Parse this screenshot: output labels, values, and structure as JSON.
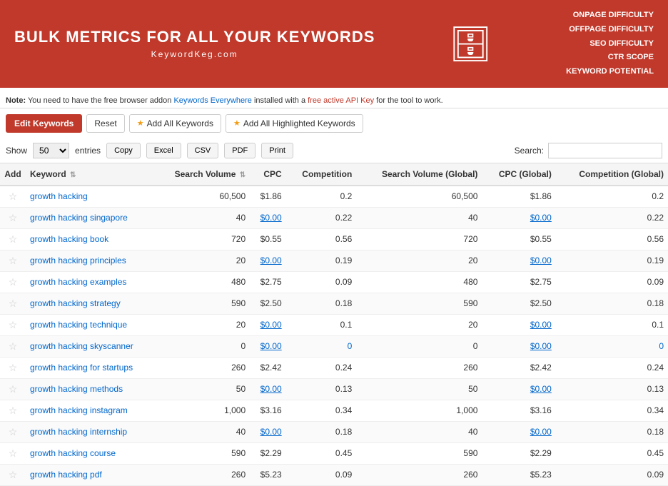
{
  "banner": {
    "title": "BULK METRICS FOR ALL YOUR KEYWORDS",
    "subtitle": "KeywordKeg.com",
    "metrics": [
      "ONPAGE DIFFICULTY",
      "OFFPAGE DIFFICULTY",
      "SEO DIFFICULTY",
      "CTR SCOPE",
      "KEYWORD POTENTIAL"
    ]
  },
  "note": {
    "prefix": "Note:",
    "text1": "You need to have the free browser addon ",
    "link1": "Keywords Everywhere",
    "text2": " installed with a ",
    "link2": "free active API Key",
    "text3": " for the tool to work."
  },
  "toolbar": {
    "edit_label": "Edit Keywords",
    "reset_label": "Reset",
    "add_all_label": "Add All Keywords",
    "add_highlighted_label": "Add All Highlighted Keywords"
  },
  "show_row": {
    "show_label": "Show",
    "entries_value": "50",
    "entries_label": "entries",
    "buttons": [
      "Copy",
      "Excel",
      "CSV",
      "PDF",
      "Print"
    ],
    "search_label": "Search:"
  },
  "table": {
    "headers": [
      "Add",
      "Keyword",
      "Search Volume",
      "CPC",
      "Competition",
      "Search Volume (Global)",
      "CPC (Global)",
      "Competition (Global)"
    ],
    "rows": [
      {
        "keyword": "growth hacking",
        "sv": "60,500",
        "cpc": "$1.86",
        "comp": "0.2",
        "sv_global": "60,500",
        "cpc_global": "$1.86",
        "comp_global": "0.2"
      },
      {
        "keyword": "growth hacking singapore",
        "sv": "40",
        "cpc": "$0.00",
        "comp": "0.22",
        "sv_global": "40",
        "cpc_global": "$0.00",
        "comp_global": "0.22"
      },
      {
        "keyword": "growth hacking book",
        "sv": "720",
        "cpc": "$0.55",
        "comp": "0.56",
        "sv_global": "720",
        "cpc_global": "$0.55",
        "comp_global": "0.56"
      },
      {
        "keyword": "growth hacking principles",
        "sv": "20",
        "cpc": "$0.00",
        "comp": "0.19",
        "sv_global": "20",
        "cpc_global": "$0.00",
        "comp_global": "0.19"
      },
      {
        "keyword": "growth hacking examples",
        "sv": "480",
        "cpc": "$2.75",
        "comp": "0.09",
        "sv_global": "480",
        "cpc_global": "$2.75",
        "comp_global": "0.09"
      },
      {
        "keyword": "growth hacking strategy",
        "sv": "590",
        "cpc": "$2.50",
        "comp": "0.18",
        "sv_global": "590",
        "cpc_global": "$2.50",
        "comp_global": "0.18"
      },
      {
        "keyword": "growth hacking technique",
        "sv": "20",
        "cpc": "$0.00",
        "comp": "0.1",
        "sv_global": "20",
        "cpc_global": "$0.00",
        "comp_global": "0.1"
      },
      {
        "keyword": "growth hacking skyscanner",
        "sv": "0",
        "cpc": "$0.00",
        "comp": "0",
        "sv_global": "0",
        "cpc_global": "$0.00",
        "comp_global": "0"
      },
      {
        "keyword": "growth hacking for startups",
        "sv": "260",
        "cpc": "$2.42",
        "comp": "0.24",
        "sv_global": "260",
        "cpc_global": "$2.42",
        "comp_global": "0.24"
      },
      {
        "keyword": "growth hacking methods",
        "sv": "50",
        "cpc": "$0.00",
        "comp": "0.13",
        "sv_global": "50",
        "cpc_global": "$0.00",
        "comp_global": "0.13"
      },
      {
        "keyword": "growth hacking instagram",
        "sv": "1,000",
        "cpc": "$3.16",
        "comp": "0.34",
        "sv_global": "1,000",
        "cpc_global": "$3.16",
        "comp_global": "0.34"
      },
      {
        "keyword": "growth hacking internship",
        "sv": "40",
        "cpc": "$0.00",
        "comp": "0.18",
        "sv_global": "40",
        "cpc_global": "$0.00",
        "comp_global": "0.18"
      },
      {
        "keyword": "growth hacking course",
        "sv": "590",
        "cpc": "$2.29",
        "comp": "0.45",
        "sv_global": "590",
        "cpc_global": "$2.29",
        "comp_global": "0.45"
      },
      {
        "keyword": "growth hacking pdf",
        "sv": "260",
        "cpc": "$5.23",
        "comp": "0.09",
        "sv_global": "260",
        "cpc_global": "$5.23",
        "comp_global": "0.09"
      }
    ]
  }
}
